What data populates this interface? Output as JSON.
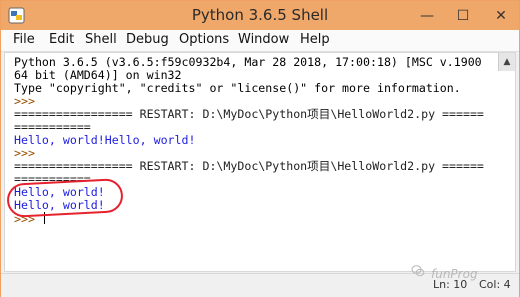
{
  "window": {
    "title": "Python 3.6.5 Shell",
    "controls": {
      "minimize": "—",
      "maximize": "☐",
      "close": "✕"
    }
  },
  "menubar": {
    "items": [
      "File",
      "Edit",
      "Shell",
      "Debug",
      "Options",
      "Window",
      "Help"
    ]
  },
  "shell": {
    "lines": [
      {
        "text": "Python 3.6.5 (v3.6.5:f59c0932b4, Mar 28 2018, 17:00:18) [MSC v.1900",
        "kind": "normal"
      },
      {
        "text": "64 bit (AMD64)] on win32",
        "kind": "normal"
      },
      {
        "text": "Type \"copyright\", \"credits\" or \"license()\" for more information.",
        "kind": "normal"
      },
      {
        "text": ">>> ",
        "kind": "prompt"
      },
      {
        "text": "================= RESTART: D:\\MyDoc\\Python项目\\HelloWorld2.py ======",
        "kind": "restart"
      },
      {
        "text": "===========",
        "kind": "restart"
      },
      {
        "text": "Hello, world!Hello, world!",
        "kind": "output"
      },
      {
        "text": ">>> ",
        "kind": "prompt"
      },
      {
        "text": "================= RESTART: D:\\MyDoc\\Python项目\\HelloWorld2.py ======",
        "kind": "restart"
      },
      {
        "text": "===========",
        "kind": "restart"
      },
      {
        "text": "Hello, world!",
        "kind": "output"
      },
      {
        "text": "Hello, world!",
        "kind": "output"
      },
      {
        "text": ">>> ",
        "kind": "prompt"
      }
    ]
  },
  "statusbar": {
    "line": "Ln: 10",
    "col": "Col: 4"
  },
  "watermark": {
    "text": "funProg"
  },
  "colors": {
    "titlebar": "#f0a86a",
    "output": "#1d1de0",
    "prompt": "#9a4f00",
    "highlight": "#e5222d"
  },
  "icons": {
    "app": "python-idle-icon",
    "watermark": "wechat-icon"
  }
}
